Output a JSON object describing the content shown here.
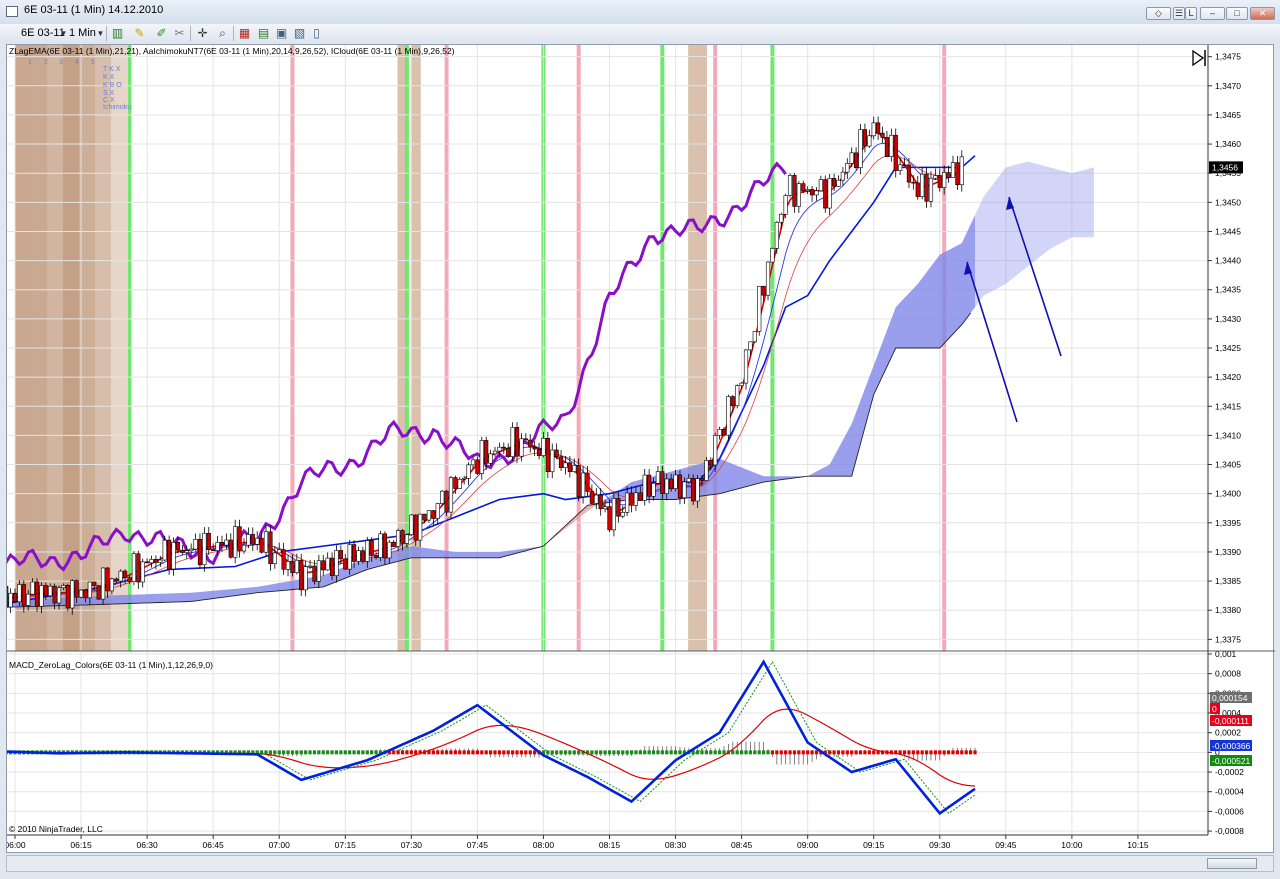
{
  "window": {
    "title": "6E 03-11 (1 Min)  14.12.2010",
    "controls": [
      "◇",
      "☰",
      "L",
      "–",
      "□",
      "✕"
    ]
  },
  "toolbar": {
    "instrument": "6E 03-11",
    "interval": "1 Min"
  },
  "price_panel": {
    "indicator_caption": "ZLagEMA(6E 03-11 (1 Min),21,21), AaIchimokuNT7(6E 03-11 (1 Min),20,14,9,26,52), ICloud(6E 03-11 (1 Min),9,26,52)",
    "legend_numbers": [
      "1",
      "2",
      "3",
      "4",
      "5"
    ],
    "legend_labels": [
      "T K X",
      "K X",
      "K B O",
      "S X",
      "C X",
      "Ichimoku"
    ],
    "price_tag": "1,3456",
    "y_ticks": [
      "1,3475",
      "1,3470",
      "1,3465",
      "1,3460",
      "1,3455",
      "1,3450",
      "1,3445",
      "1,3440",
      "1,3435",
      "1,3430",
      "1,3425",
      "1,3420",
      "1,3415",
      "1,3410",
      "1,3405",
      "1,3400",
      "1,3395",
      "1,3390",
      "1,3385",
      "1,3380",
      "1,3375"
    ],
    "y_range": [
      1.3373,
      1.3477
    ]
  },
  "macd_panel": {
    "caption": "MACD_ZeroLag_Colors(6E 03-11 (1 Min),1,12,26,9,0)",
    "y_ticks": [
      "0,001",
      "0,0008",
      "0,0006",
      "0,0004",
      "0,0002",
      "0",
      "-0,0002",
      "-0,0004",
      "-0,0006",
      "-0,0008"
    ],
    "tags": [
      {
        "text": "0,000154",
        "color": "#6e6e6e",
        "value": 0.000154
      },
      {
        "text": "0",
        "color": "#e8001c",
        "value": 0.0
      },
      {
        "text": "-0,000111",
        "color": "#e8001c",
        "value": -0.000111
      },
      {
        "text": "-0,000366",
        "color": "#1434d8",
        "value": -0.000366
      },
      {
        "text": "-0,000521",
        "color": "#0f8a0f",
        "value": -0.000521
      }
    ],
    "y_range": [
      -0.00084,
      0.00102
    ],
    "copyright": "© 2010 NinjaTrader, LLC"
  },
  "x_axis": {
    "labels": [
      "06:00",
      "06:15",
      "06:30",
      "06:45",
      "07:00",
      "07:15",
      "07:30",
      "07:45",
      "08:00",
      "08:15",
      "08:30",
      "08:45",
      "09:00",
      "09:15",
      "09:30",
      "09:45",
      "10:00",
      "10:15"
    ],
    "start_minute": 360,
    "end_minute": 630
  },
  "colors": {
    "candle_up": "#ffffff",
    "candle_down": "#cc0000",
    "candle_border": "#000000",
    "ichimoku_line": "#8a10c8",
    "zlag_red": "#e00000",
    "kijun_blue": "#0018e0",
    "cloud_blue": "#7f86e8",
    "cloud_red": "#e8a0a0",
    "macd_blue": "#0022dd",
    "signal_green": "#1a8a1a",
    "avg_red": "#dd0000",
    "vbar_green": "#6ee86e",
    "vbar_pink": "#f4a9b8",
    "vbar_tan": "#d9c1ad",
    "grid": "#e4e4e4",
    "arrow": "#1010b0"
  },
  "chart_data": {
    "type": "line",
    "x_unit": "time (HH:MM)",
    "instrument": "6E 03-11 (1 Min)",
    "close_series": {
      "name": "6E 03-11 (1 Min)",
      "x": [
        "05:57",
        "06:05",
        "06:15",
        "06:25",
        "06:35",
        "06:45",
        "06:55",
        "07:05",
        "07:15",
        "07:25",
        "07:35",
        "07:45",
        "07:55",
        "08:05",
        "08:15",
        "08:25",
        "08:35",
        "08:45",
        "08:55",
        "09:05",
        "09:15",
        "09:25",
        "09:35"
      ],
      "values": [
        1.3382,
        1.3383,
        1.3383,
        1.3386,
        1.339,
        1.3391,
        1.3392,
        1.3386,
        1.3389,
        1.3391,
        1.3397,
        1.3406,
        1.3409,
        1.3405,
        1.3396,
        1.3402,
        1.3401,
        1.342,
        1.3452,
        1.3452,
        1.3463,
        1.3452,
        1.3456
      ]
    },
    "ichimoku_chikou": {
      "x": [
        "05:57",
        "06:05",
        "06:15",
        "06:25",
        "06:35",
        "06:45",
        "06:55",
        "07:05",
        "07:15",
        "07:25",
        "07:35",
        "07:45",
        "07:55",
        "08:05",
        "08:15",
        "08:25",
        "08:35",
        "08:45",
        "08:55"
      ],
      "values": [
        1.3387,
        1.3389,
        1.3389,
        1.3394,
        1.3391,
        1.339,
        1.3392,
        1.3402,
        1.3405,
        1.341,
        1.3411,
        1.3405,
        1.3408,
        1.3413,
        1.3433,
        1.3445,
        1.3445,
        1.345,
        1.3456
      ]
    },
    "macd": {
      "x": [
        "05:57",
        "06:10",
        "06:25",
        "06:40",
        "06:55",
        "07:05",
        "07:20",
        "07:35",
        "07:45",
        "08:00",
        "08:10",
        "08:20",
        "08:30",
        "08:40",
        "08:50",
        "09:00",
        "09:10",
        "09:20",
        "09:30",
        "09:38"
      ],
      "values": [
        1e-05,
        -1e-05,
        0.0,
        -1e-05,
        -2e-05,
        -0.00028,
        -8e-05,
        0.00022,
        0.00048,
        -3e-05,
        -0.00025,
        -0.0005,
        -8e-05,
        0.0002,
        0.00092,
        0.0001,
        -0.0002,
        -7e-05,
        -0.00062,
        -0.00037
      ]
    },
    "arrows_to_cloud": 2
  }
}
